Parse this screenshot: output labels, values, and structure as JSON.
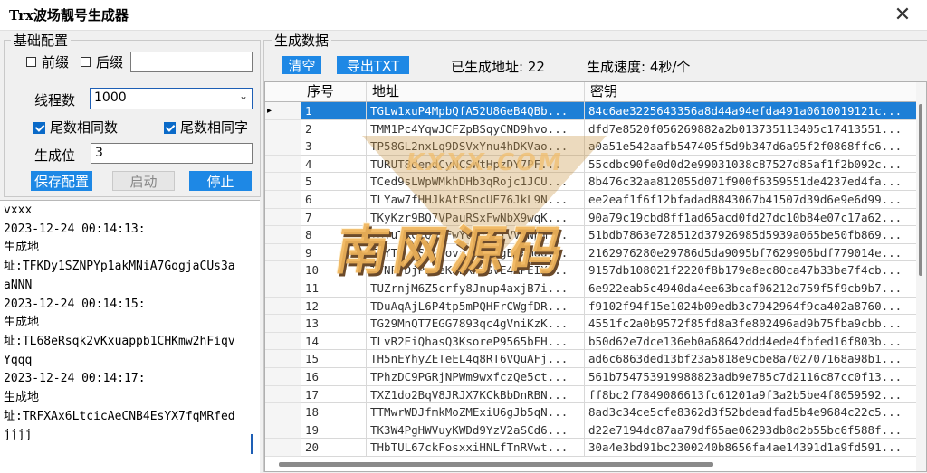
{
  "window": {
    "title": "Trx波场靓号生成器",
    "close_glyph": "✕"
  },
  "basic_config": {
    "legend": "基础配置",
    "prefix_label": "前缀",
    "suffix_label": "后缀",
    "suffix_value": "",
    "threads_label": "线程数",
    "threads_value": "1000",
    "tail_same_num_label": "尾数相同数",
    "tail_same_char_label": "尾数相同字",
    "gen_pos_label": "生成位",
    "gen_pos_value": "3",
    "save_button": "保存配置",
    "start_button": "启动",
    "stop_button": "停止"
  },
  "log_lines": [
    "vxxx",
    "2023-12-24 00:14:13:",
    "生成地",
    "址:TFKDy1SZNPYp1akMNiA7GogjaCUs3a",
    "aNNN",
    "2023-12-24 00:14:15:",
    "生成地",
    "址:TL68eRsqk2vKxuappb1CHKmw2hFiqv",
    "Yqqq",
    "2023-12-24 00:14:17:",
    "生成地",
    "址:TRFXAx6LtcicAeCNB4EsYX7fqMRfed",
    "jjjj"
  ],
  "gen_data": {
    "legend": "生成数据",
    "clear_button": "清空",
    "export_button": "导出TXT",
    "generated_label": "已生成地址: 22",
    "speed_label": "生成速度: 4秒/个"
  },
  "table": {
    "headers": {
      "index": "序号",
      "address": "地址",
      "key": "密钥"
    },
    "rows": [
      {
        "index": "1",
        "address": "TGLw1xuP4MpbQfA52U8GeB4QBb...",
        "key": "84c6ae3225643356a8d44a94efda491a0610019121c..."
      },
      {
        "index": "2",
        "address": "TMM1Pc4YqwJCFZpBSqyCND9hvo...",
        "key": "dfd7e8520f056269882a2b013735113405c17413551..."
      },
      {
        "index": "3",
        "address": "TP58GL2nxLq9DSVxYnu4hDKVao...",
        "key": "a0a51e542aafb547405f5d9b347d6a95f2f0868ffc6..."
      },
      {
        "index": "4",
        "address": "TURUT8dendCyNCSWtHpzDY7PF...",
        "key": "55cdbc90fe0d0d2e99031038c87527d85af1f2b092c..."
      },
      {
        "index": "5",
        "address": "TCed9sLWpWMkhDHb3qRojc1JCU...",
        "key": "8b476c32aa812055d071f900f6359551de4237ed4fa..."
      },
      {
        "index": "6",
        "address": "TLYaw7fHHJkAtRSncUE76JkL9N...",
        "key": "ee2eaf1f6f12bfadad8843067b41507d39d6e9e6d99..."
      },
      {
        "index": "7",
        "address": "TKyKzr9BQ7VPauRSxFwNbX9wqK...",
        "key": "90a79c19cbd8ff1ad65acd0fd27dc10b84e07c17a62..."
      },
      {
        "index": "8",
        "address": "THYuTKCjQWuFwYcRjRsfVVyNpm...",
        "key": "51bdb7863e728512d37926985d5939a065be50fb869..."
      },
      {
        "index": "9",
        "address": "TPYTgu7SKNroval1P3rgEdxmgd...",
        "key": "2162976280e29786d5da9095bf7629906bdf779014e..."
      },
      {
        "index": "10",
        "address": "TTNPvDjPweeKdnXPGSVE4RPEIX...",
        "key": "9157db108021f2220f8b179e8ec80ca47b33be7f4cb..."
      },
      {
        "index": "11",
        "address": "TUZrnjM6Z5crfy8Jnup4axjB7i...",
        "key": "6e922eab5c4940da4ee63bcaf06212d759f5f9cb9b7..."
      },
      {
        "index": "12",
        "address": "TDuAqAjL6P4tp5mPQHFrCWgfDR...",
        "key": "f9102f94f15e1024b09edb3c7942964f9ca402a8760..."
      },
      {
        "index": "13",
        "address": "TG29MnQT7EGG7893qc4gVniKzK...",
        "key": "4551fc2a0b9572f85fd8a3fe802496ad9b75fba9cbb..."
      },
      {
        "index": "14",
        "address": "TLvR2EiQhasQ3KsoreP9565bFH...",
        "key": "b50d62e7dce136eb0a68642ddd4ede4fbfed16f803b..."
      },
      {
        "index": "15",
        "address": "TH5nEYhyZETeEL4q8RT6VQuAFj...",
        "key": "ad6c6863ded13bf23a5818e9cbe8a702707168a98b1..."
      },
      {
        "index": "16",
        "address": "TPhzDC9PGRjNPWm9wxfczQe5ct...",
        "key": "561b754753919988823adb9e785c7d2116c87cc0f13..."
      },
      {
        "index": "17",
        "address": "TXZ1do2BqV8JRJX7KCkBbDnRBN...",
        "key": "ff8bc2f7849086613fc61201a9f3a2b5be4f8059592..."
      },
      {
        "index": "18",
        "address": "TTMwrWDJfmkMoZMExiU6gJb5qN...",
        "key": "8ad3c34ce5cfe8362d3f52bdeadfad5b4e9684c22c5..."
      },
      {
        "index": "19",
        "address": "TK3W4PgHWVuyKWDd9YzV2aSCd6...",
        "key": "d22e7194dc87aa79df65ae06293db8d2b55bc6f588f..."
      },
      {
        "index": "20",
        "address": "THbTUL67ckFosxxiHNLfTnRVwt...",
        "key": "30a4e3bd91bc2300240b8656fa4ae14391d1a9fd591..."
      }
    ]
  },
  "watermark": {
    "sub": "KXXX.COM",
    "main": "南网源码"
  }
}
